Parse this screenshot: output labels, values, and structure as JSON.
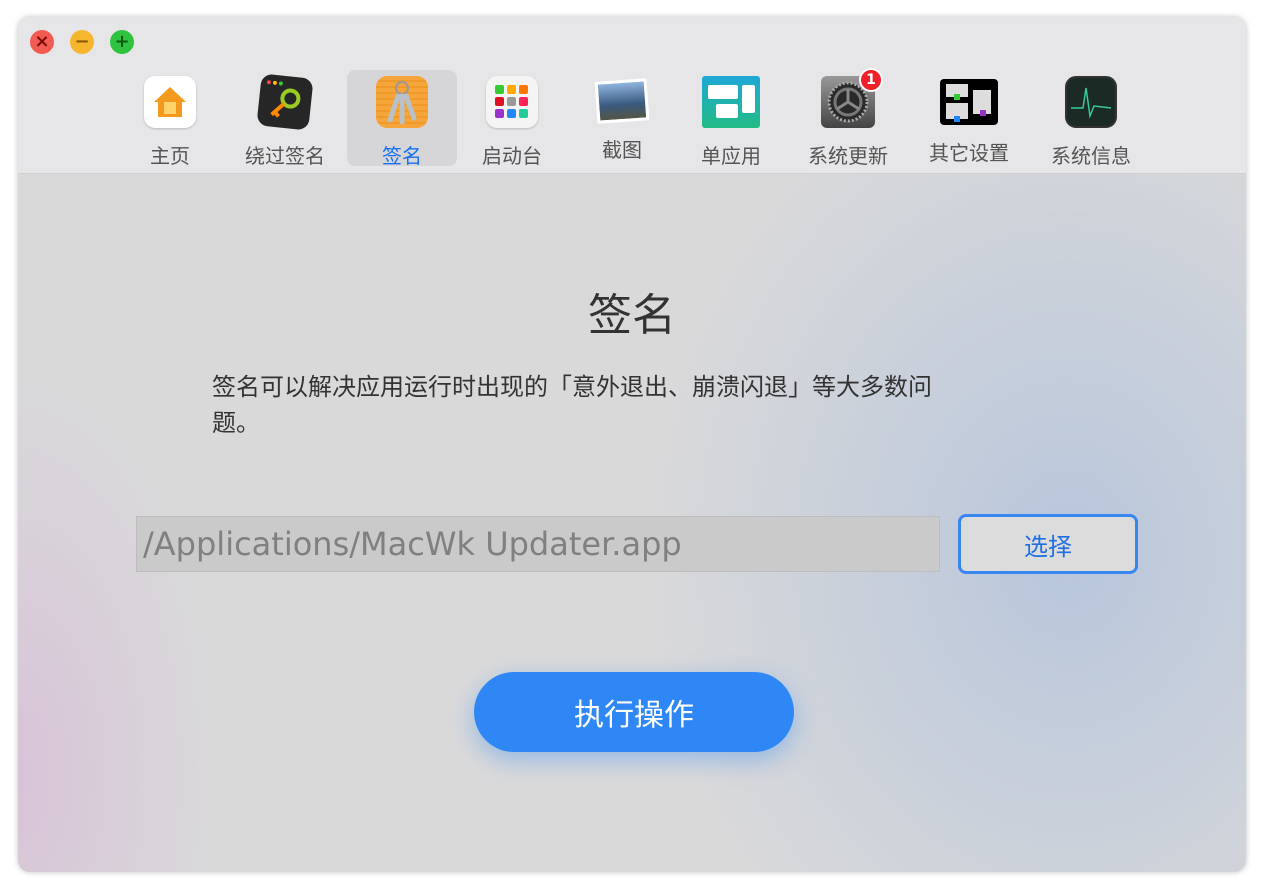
{
  "toolbar": {
    "items": [
      {
        "label": "主页",
        "icon": "home-icon"
      },
      {
        "label": "绕过签名",
        "icon": "key-terminal-icon"
      },
      {
        "label": "签名",
        "icon": "keychain-icon",
        "selected": true
      },
      {
        "label": "启动台",
        "icon": "launchpad-icon"
      },
      {
        "label": "截图",
        "icon": "screenshot-photo-icon"
      },
      {
        "label": "单应用",
        "icon": "single-app-icon"
      },
      {
        "label": "系统更新",
        "icon": "system-preferences-gear-icon",
        "badge": "1"
      },
      {
        "label": "其它设置",
        "icon": "other-settings-icon"
      },
      {
        "label": "系统信息",
        "icon": "activity-monitor-icon"
      }
    ]
  },
  "main": {
    "title": "签名",
    "description": "签名可以解决应用运行时出现的「意外退出、崩溃闪退」等大多数问题。",
    "path_value": "/Applications/MacWk Updater.app",
    "choose_label": "选择",
    "execute_label": "执行操作"
  },
  "colors": {
    "accent": "#2f87f5",
    "selected_text": "#1670f0",
    "badge": "#f0202a"
  }
}
